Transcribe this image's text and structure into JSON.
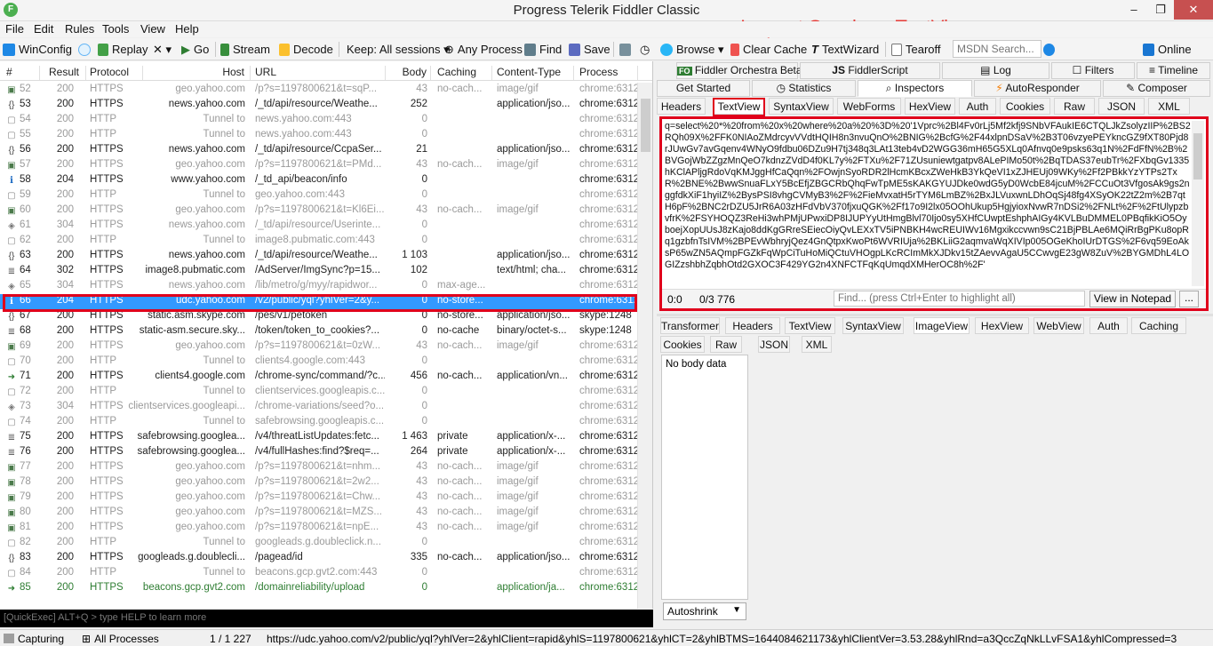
{
  "window": {
    "title": "Progress Telerik Fiddler Classic",
    "annotation": "Inspect Session - TextView",
    "app_icon": "F",
    "controls": [
      "–",
      "❐",
      "✕"
    ]
  },
  "menu": [
    "File",
    "Edit",
    "Rules",
    "Tools",
    "View",
    "Help"
  ],
  "toolbar": {
    "winconfig": "WinConfig",
    "replay": "Replay",
    "remove": "✕ ▾",
    "go": "Go",
    "stream": "Stream",
    "decode": "Decode",
    "keep": "Keep: All sessions ▾",
    "any_process": "Any Process",
    "find": "Find",
    "save": "Save",
    "browse": "Browse ▾",
    "clear_cache": "Clear Cache",
    "textwizard": "TextWizard",
    "tearoff": "Tearoff",
    "msdn_placeholder": "MSDN Search...",
    "online": "Online"
  },
  "grid": {
    "columns": [
      "#",
      "Result",
      "Protocol",
      "Host",
      "URL",
      "Body",
      "Caching",
      "Content-Type",
      "Process"
    ],
    "rows": [
      {
        "icon": "img",
        "num": "52",
        "result": "200",
        "protocol": "HTTPS",
        "host": "geo.yahoo.com",
        "url": "/p?s=1197800621&t=sqP...",
        "body": "43",
        "caching": "no-cach...",
        "ctype": "image/gif",
        "process": "chrome:6312",
        "style": "grey"
      },
      {
        "icon": "json",
        "num": "53",
        "result": "200",
        "protocol": "HTTPS",
        "host": "news.yahoo.com",
        "url": "/_td/api/resource/Weathe...",
        "body": "252",
        "caching": "",
        "ctype": "application/jso...",
        "process": "chrome:6312",
        "style": ""
      },
      {
        "icon": "lock",
        "num": "54",
        "result": "200",
        "protocol": "HTTP",
        "host": "Tunnel to",
        "url": "news.yahoo.com:443",
        "body": "0",
        "caching": "",
        "ctype": "",
        "process": "chrome:6312",
        "style": "grey"
      },
      {
        "icon": "lock",
        "num": "55",
        "result": "200",
        "protocol": "HTTP",
        "host": "Tunnel to",
        "url": "news.yahoo.com:443",
        "body": "0",
        "caching": "",
        "ctype": "",
        "process": "chrome:6312",
        "style": "grey"
      },
      {
        "icon": "json",
        "num": "56",
        "result": "200",
        "protocol": "HTTPS",
        "host": "news.yahoo.com",
        "url": "/_td/api/resource/CcpaSer...",
        "body": "21",
        "caching": "",
        "ctype": "application/jso...",
        "process": "chrome:6312",
        "style": ""
      },
      {
        "icon": "img",
        "num": "57",
        "result": "200",
        "protocol": "HTTPS",
        "host": "geo.yahoo.com",
        "url": "/p?s=1197800621&t=PMd...",
        "body": "43",
        "caching": "no-cach...",
        "ctype": "image/gif",
        "process": "chrome:6312",
        "style": "grey"
      },
      {
        "icon": "info",
        "num": "58",
        "result": "204",
        "protocol": "HTTPS",
        "host": "www.yahoo.com",
        "url": "/_td_api/beacon/info",
        "body": "0",
        "caching": "",
        "ctype": "",
        "process": "chrome:6312",
        "style": ""
      },
      {
        "icon": "lock",
        "num": "59",
        "result": "200",
        "protocol": "HTTP",
        "host": "Tunnel to",
        "url": "geo.yahoo.com:443",
        "body": "0",
        "caching": "",
        "ctype": "",
        "process": "chrome:6312",
        "style": "grey"
      },
      {
        "icon": "img",
        "num": "60",
        "result": "200",
        "protocol": "HTTPS",
        "host": "geo.yahoo.com",
        "url": "/p?s=1197800621&t=Kl6Ei...",
        "body": "43",
        "caching": "no-cach...",
        "ctype": "image/gif",
        "process": "chrome:6312",
        "style": "grey"
      },
      {
        "icon": "cache",
        "num": "61",
        "result": "304",
        "protocol": "HTTPS",
        "host": "news.yahoo.com",
        "url": "/_td/api/resource/Userinte...",
        "body": "0",
        "caching": "",
        "ctype": "",
        "process": "chrome:6312",
        "style": "grey"
      },
      {
        "icon": "lock",
        "num": "62",
        "result": "200",
        "protocol": "HTTP",
        "host": "Tunnel to",
        "url": "image8.pubmatic.com:443",
        "body": "0",
        "caching": "",
        "ctype": "",
        "process": "chrome:6312",
        "style": "grey"
      },
      {
        "icon": "json",
        "num": "63",
        "result": "200",
        "protocol": "HTTPS",
        "host": "news.yahoo.com",
        "url": "/_td/api/resource/Weathe...",
        "body": "1 103",
        "caching": "",
        "ctype": "application/jso...",
        "process": "chrome:6312",
        "style": ""
      },
      {
        "icon": "doc",
        "num": "64",
        "result": "302",
        "protocol": "HTTPS",
        "host": "image8.pubmatic.com",
        "url": "/AdServer/ImgSync?p=15...",
        "body": "102",
        "caching": "",
        "ctype": "text/html; cha...",
        "process": "chrome:6312",
        "style": ""
      },
      {
        "icon": "cache",
        "num": "65",
        "result": "304",
        "protocol": "HTTPS",
        "host": "news.yahoo.com",
        "url": "/lib/metro/g/myy/rapidwor...",
        "body": "0",
        "caching": "max-age...",
        "ctype": "",
        "process": "chrome:6312",
        "style": "grey"
      },
      {
        "icon": "info",
        "num": "66",
        "result": "204",
        "protocol": "HTTPS",
        "host": "udc.yahoo.com",
        "url": "/v2/public/yql?yhlVer=2&y...",
        "body": "0",
        "caching": "no-store...",
        "ctype": "",
        "process": "chrome:6312",
        "style": "sel"
      },
      {
        "icon": "json",
        "num": "67",
        "result": "200",
        "protocol": "HTTPS",
        "host": "static.asm.skype.com",
        "url": "/pes/v1/petoken",
        "body": "0",
        "caching": "no-store...",
        "ctype": "application/jso...",
        "process": "skype:1248",
        "style": ""
      },
      {
        "icon": "doc",
        "num": "68",
        "result": "200",
        "protocol": "HTTPS",
        "host": "static-asm.secure.sky...",
        "url": "/token/token_to_cookies?...",
        "body": "0",
        "caching": "no-cache",
        "ctype": "binary/octet-s...",
        "process": "skype:1248",
        "style": ""
      },
      {
        "icon": "img",
        "num": "69",
        "result": "200",
        "protocol": "HTTPS",
        "host": "geo.yahoo.com",
        "url": "/p?s=1197800621&t=0zW...",
        "body": "43",
        "caching": "no-cach...",
        "ctype": "image/gif",
        "process": "chrome:6312",
        "style": "grey"
      },
      {
        "icon": "lock",
        "num": "70",
        "result": "200",
        "protocol": "HTTP",
        "host": "Tunnel to",
        "url": "clients4.google.com:443",
        "body": "0",
        "caching": "",
        "ctype": "",
        "process": "chrome:6312",
        "style": "grey"
      },
      {
        "icon": "arrow",
        "num": "71",
        "result": "200",
        "protocol": "HTTPS",
        "host": "clients4.google.com",
        "url": "/chrome-sync/command/?c...",
        "body": "456",
        "caching": "no-cach...",
        "ctype": "application/vn...",
        "process": "chrome:6312",
        "style": ""
      },
      {
        "icon": "lock",
        "num": "72",
        "result": "200",
        "protocol": "HTTP",
        "host": "Tunnel to",
        "url": "clientservices.googleapis.c...",
        "body": "0",
        "caching": "",
        "ctype": "",
        "process": "chrome:6312",
        "style": "grey"
      },
      {
        "icon": "cache",
        "num": "73",
        "result": "304",
        "protocol": "HTTPS",
        "host": "clientservices.googleapi...",
        "url": "/chrome-variations/seed?o...",
        "body": "0",
        "caching": "",
        "ctype": "",
        "process": "chrome:6312",
        "style": "grey"
      },
      {
        "icon": "lock",
        "num": "74",
        "result": "200",
        "protocol": "HTTP",
        "host": "Tunnel to",
        "url": "safebrowsing.googleapis.c...",
        "body": "0",
        "caching": "",
        "ctype": "",
        "process": "chrome:6312",
        "style": "grey"
      },
      {
        "icon": "doc",
        "num": "75",
        "result": "200",
        "protocol": "HTTPS",
        "host": "safebrowsing.googlea...",
        "url": "/v4/threatListUpdates:fetc...",
        "body": "1 463",
        "caching": "private",
        "ctype": "application/x-...",
        "process": "chrome:6312",
        "style": ""
      },
      {
        "icon": "doc",
        "num": "76",
        "result": "200",
        "protocol": "HTTPS",
        "host": "safebrowsing.googlea...",
        "url": "/v4/fullHashes:find?$req=...",
        "body": "264",
        "caching": "private",
        "ctype": "application/x-...",
        "process": "chrome:6312",
        "style": ""
      },
      {
        "icon": "img",
        "num": "77",
        "result": "200",
        "protocol": "HTTPS",
        "host": "geo.yahoo.com",
        "url": "/p?s=1197800621&t=nhm...",
        "body": "43",
        "caching": "no-cach...",
        "ctype": "image/gif",
        "process": "chrome:6312",
        "style": "grey"
      },
      {
        "icon": "img",
        "num": "78",
        "result": "200",
        "protocol": "HTTPS",
        "host": "geo.yahoo.com",
        "url": "/p?s=1197800621&t=2w2...",
        "body": "43",
        "caching": "no-cach...",
        "ctype": "image/gif",
        "process": "chrome:6312",
        "style": "grey"
      },
      {
        "icon": "img",
        "num": "79",
        "result": "200",
        "protocol": "HTTPS",
        "host": "geo.yahoo.com",
        "url": "/p?s=1197800621&t=Chw...",
        "body": "43",
        "caching": "no-cach...",
        "ctype": "image/gif",
        "process": "chrome:6312",
        "style": "grey"
      },
      {
        "icon": "img",
        "num": "80",
        "result": "200",
        "protocol": "HTTPS",
        "host": "geo.yahoo.com",
        "url": "/p?s=1197800621&t=MZS...",
        "body": "43",
        "caching": "no-cach...",
        "ctype": "image/gif",
        "process": "chrome:6312",
        "style": "grey"
      },
      {
        "icon": "img",
        "num": "81",
        "result": "200",
        "protocol": "HTTPS",
        "host": "geo.yahoo.com",
        "url": "/p?s=1197800621&t=npE...",
        "body": "43",
        "caching": "no-cach...",
        "ctype": "image/gif",
        "process": "chrome:6312",
        "style": "grey"
      },
      {
        "icon": "lock",
        "num": "82",
        "result": "200",
        "protocol": "HTTP",
        "host": "Tunnel to",
        "url": "googleads.g.doubleclick.n...",
        "body": "0",
        "caching": "",
        "ctype": "",
        "process": "chrome:6312",
        "style": "grey"
      },
      {
        "icon": "json",
        "num": "83",
        "result": "200",
        "protocol": "HTTPS",
        "host": "googleads.g.doublecli...",
        "url": "/pagead/id",
        "body": "335",
        "caching": "no-cach...",
        "ctype": "application/jso...",
        "process": "chrome:6312",
        "style": ""
      },
      {
        "icon": "lock",
        "num": "84",
        "result": "200",
        "protocol": "HTTP",
        "host": "Tunnel to",
        "url": "beacons.gcp.gvt2.com:443",
        "body": "0",
        "caching": "",
        "ctype": "",
        "process": "chrome:6312",
        "style": "grey"
      },
      {
        "icon": "arrow",
        "num": "85",
        "result": "200",
        "protocol": "HTTPS",
        "host": "beacons.gcp.gvt2.com",
        "url": "/domainreliability/upload",
        "body": "0",
        "caching": "",
        "ctype": "application/ja...",
        "process": "chrome:6312",
        "style": "green"
      }
    ]
  },
  "quickexec": "[QuickExec] ALT+Q > type HELP to learn more",
  "inspector": {
    "top_tabs_row1": [
      "Fiddler Orchestra Beta",
      "FiddlerScript",
      "Log",
      "Filters",
      "Timeline"
    ],
    "top_tabs_row2": [
      "Get Started",
      "Statistics",
      "Inspectors",
      "AutoResponder",
      "Composer"
    ],
    "request_tabs": [
      "Headers",
      "TextView",
      "SyntaxView",
      "WebForms",
      "HexView",
      "Auth",
      "Cookies",
      "Raw",
      "JSON",
      "XML"
    ],
    "request_text": "q=select%20*%20from%20x%20where%20a%20%3D%20'1Vprc%2Bl4Fv0rLj5Mf2kfj9SNbVFAukIE6CTQLJkZsolyzIIP%2BS2RQh09X%2FFK0NIAoZMdrcyvVVdtHQIH8n3nvuQnO%2BNIG%2BcfG%2F44xlpnDSaV%2B3T06vzyePEYkncGZ9fXT80Pjd8rJUwGv7avGqenv4WNyO9fdbu06DZu9H7tj348q3LAt13teb4vD2WGG36mH65G5XLq0Afnvq0e9psks63q1N%2FdFfN%2B%2BVGojWbZZgzMnQeO7kdnzZVdD4f0KL7y%2FTXu%2F71ZUsuniewtgatpv8ALePIMo50t%2BqTDAS37eubTr%2FXbqGv1335hKClAPljgRdoVqKMJggHfCaQqn%2FOwjnSyoRDR2lHcmKBcxZWeHkB3YkQeVI1xZJHEUj09WKy%2Ff2PBkkYzYTPs2TxR%2BNE%2BwwSnuaFLxY5BcEfjZBGCRbQhqFwTpME5sKAKGYUJDke0wdG5yD0WcbE84jcuM%2FCCuOt3VfgosAk9gs2nggfdkXiF1hyiIZ%2BysPSI8vhgCVMyB3%2F%2FieMvxatH5rTYM6LmBZ%2BxJLVuxwnLDhOqSj48fg4XSyOK22tZ2m%2B7qtH6pF%2BNC2rDZU5JrR6A03zHFdVbV370fjxuQGK%2Ff17o9I2lx05OOhUkup5HgjyioxNvwR7nDSi2%2FNLt%2F%2FtUlypzbvfrK%2FSYHOQZ3ReHi3whPMjUPwxiDP8IJUPYyUtHmgBlvl70Ijo0sy5XHfCUwptEshphAIGy4KVLBuDMMEL0PBqfikKiO5OyboejXopUUsJ8zKajo8ddKgGRreSEiecOiyQvLEXxTV5iPNBKH4wcREUIWv16Mgxikccvwn9sC21BjPBLAe6MQiRrBgPKu8opRq1gzbfnTsIVM%2BPEvWbhryjQez4GnQtpxKwoPt6WVRIUja%2BKLiiG2aqmvaWqXIVIp005OGeKhoIUrDTGS%2F6vq59EoAksP65wZN5AQmpFGZkFqWpCiTuHoMiQCtuVHOgpLKcRCImMkXJDkv15tZAevvAgaU5CCwvgE23gW8ZuV%2BYGMDhL4LOGIZzshbhZqbhOtd2GXOC3F429YG2n4XNFCTFqKqUmqdXMHerOC8h%2F'",
    "cursor_pos": "0:0",
    "char_count": "0/3 776",
    "find_placeholder": "Find... (press Ctrl+Enter to highlight all)",
    "view_in_notepad": "View in Notepad",
    "more": "...",
    "response_tabs_row1": [
      "Transformer",
      "Headers",
      "TextView",
      "SyntaxView",
      "ImageView",
      "HexView",
      "WebView",
      "Auth",
      "Caching"
    ],
    "response_tabs_row2": [
      "Cookies",
      "Raw",
      "JSON",
      "XML"
    ],
    "response_body": "No body data",
    "autoshrink": "Autoshrink"
  },
  "status": {
    "capturing": "Capturing",
    "processes": "All Processes",
    "count": "1 / 1 227",
    "url": "https://udc.yahoo.com/v2/public/yql?yhlVer=2&yhlClient=rapid&yhlS=1197800621&yhlCT=2&yhlBTMS=1644084621173&yhlClientVer=3.53.28&yhlRnd=a3QccZqNkLLvFSA1&yhlCompressed=3"
  },
  "colors": {
    "selection": "#3399ff",
    "highlight_box": "#e0001b",
    "annotation": "#e53935",
    "quickexec_bg": "#000000"
  }
}
